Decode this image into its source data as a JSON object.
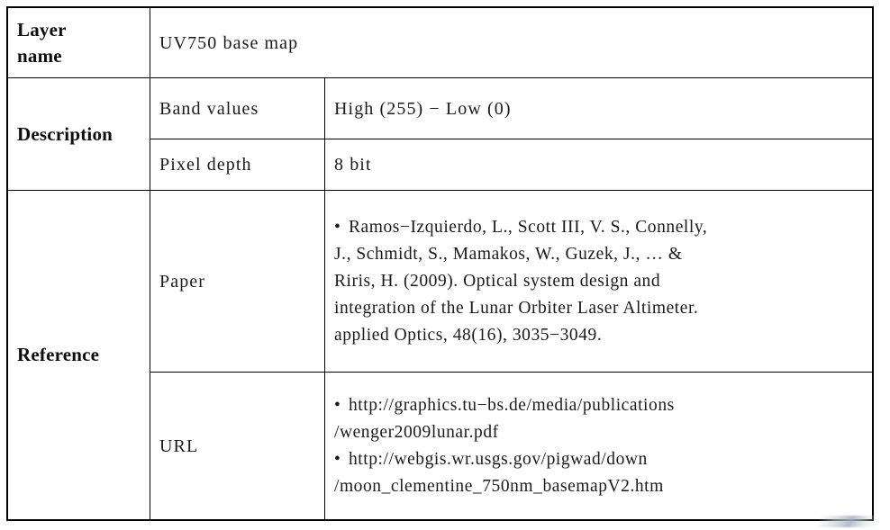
{
  "table": {
    "rows": {
      "layer_name": {
        "label_line1": "Layer",
        "label_line2": "name",
        "value": "UV750 base map"
      },
      "description": {
        "label": "Description",
        "band_values": {
          "sublabel": "Band values",
          "value": "High (255) − Low (0)"
        },
        "pixel_depth": {
          "sublabel": "Pixel depth",
          "value": "8 bit"
        }
      },
      "reference": {
        "label": "Reference",
        "paper": {
          "sublabel": "Paper",
          "lines": [
            "Ramos−Izquierdo, L., Scott III, V. S., Connelly,",
            "J., Schmidt, S., Mamakos, W., Guzek, J., … &",
            "Riris, H. (2009). Optical system design and",
            "integration of the Lunar Orbiter Laser Altimeter.",
            "applied Optics, 48(16), 3035−3049."
          ],
          "full_text": "Ramos−Izquierdo, L., Scott III, V. S., Connelly, J., Schmidt, S., Mamakos, W., Guzek, J., … & Riris, H. (2009). Optical system design and integration of the Lunar Orbiter Laser Altimeter. applied Optics, 48(16), 3035−3049."
        },
        "url": {
          "sublabel": "URL",
          "lines": [
            "http://graphics.tu−bs.de/media/publications",
            "/wenger2009lunar.pdf",
            "http://webgis.wr.usgs.gov/pigwad/down",
            "/moon_clementine_750nm_basemapV2.htm"
          ],
          "items": [
            "http://graphics.tu−bs.de/media/publications/wenger2009lunar.pdf",
            "http://webgis.wr.usgs.gov/pigwad/down/moon_clementine_750nm_basemapV2.htm"
          ]
        }
      }
    }
  },
  "colors": {
    "border": "#000000",
    "text": "#1a1a1a",
    "label_text": "#0d0d0d",
    "background": "#ffffff"
  }
}
